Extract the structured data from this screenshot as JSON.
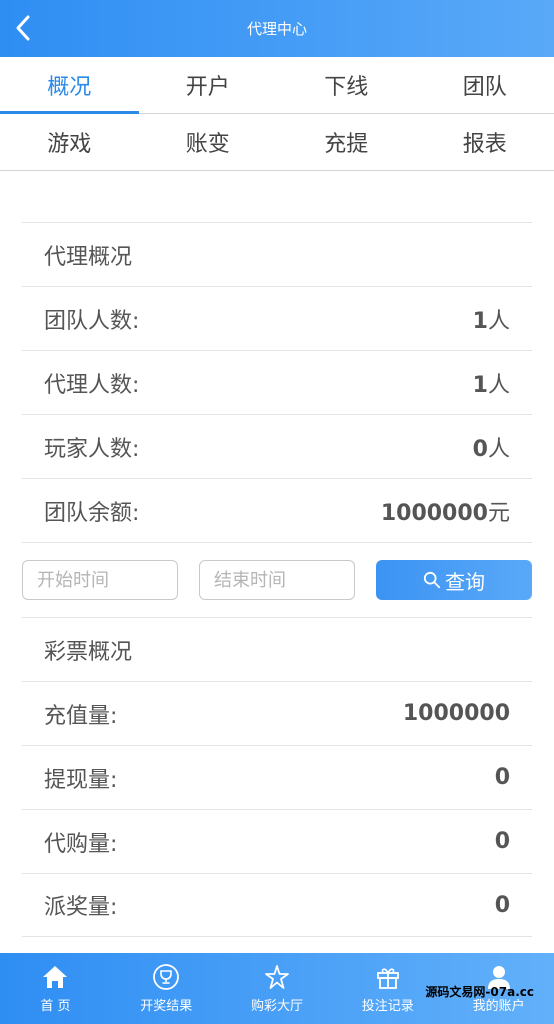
{
  "header": {
    "title": "代理中心"
  },
  "tabs": {
    "row1": [
      "概况",
      "开户",
      "下线",
      "团队"
    ],
    "row2": [
      "游戏",
      "账变",
      "充提",
      "报表"
    ]
  },
  "agent_overview": {
    "title": "代理概况",
    "rows": [
      {
        "label": "团队人数:",
        "value": "1",
        "unit": "人"
      },
      {
        "label": "代理人数:",
        "value": "1",
        "unit": "人"
      },
      {
        "label": "玩家人数:",
        "value": "0",
        "unit": "人"
      },
      {
        "label": "团队余额:",
        "value": "1000000",
        "unit": "元"
      }
    ]
  },
  "query": {
    "start_placeholder": "开始时间",
    "end_placeholder": "结束时间",
    "button_label": "查询"
  },
  "lottery_overview": {
    "title": "彩票概况",
    "rows": [
      {
        "label": "充值量:",
        "value": "1000000"
      },
      {
        "label": "提现量:",
        "value": "0"
      },
      {
        "label": "代购量:",
        "value": "0"
      },
      {
        "label": "派奖量:",
        "value": "0"
      }
    ]
  },
  "tabbar": [
    {
      "label": "首 页",
      "icon": "home-icon"
    },
    {
      "label": "开奖结果",
      "icon": "trophy-icon"
    },
    {
      "label": "购彩大厅",
      "icon": "star-icon"
    },
    {
      "label": "投注记录",
      "icon": "gift-icon"
    },
    {
      "label": "我的账户",
      "icon": "user-icon"
    }
  ],
  "watermark": "源码文易网-07a.cc",
  "colors": {
    "primary": "#2f8ef3",
    "active_tab": "#2b8ae8"
  }
}
